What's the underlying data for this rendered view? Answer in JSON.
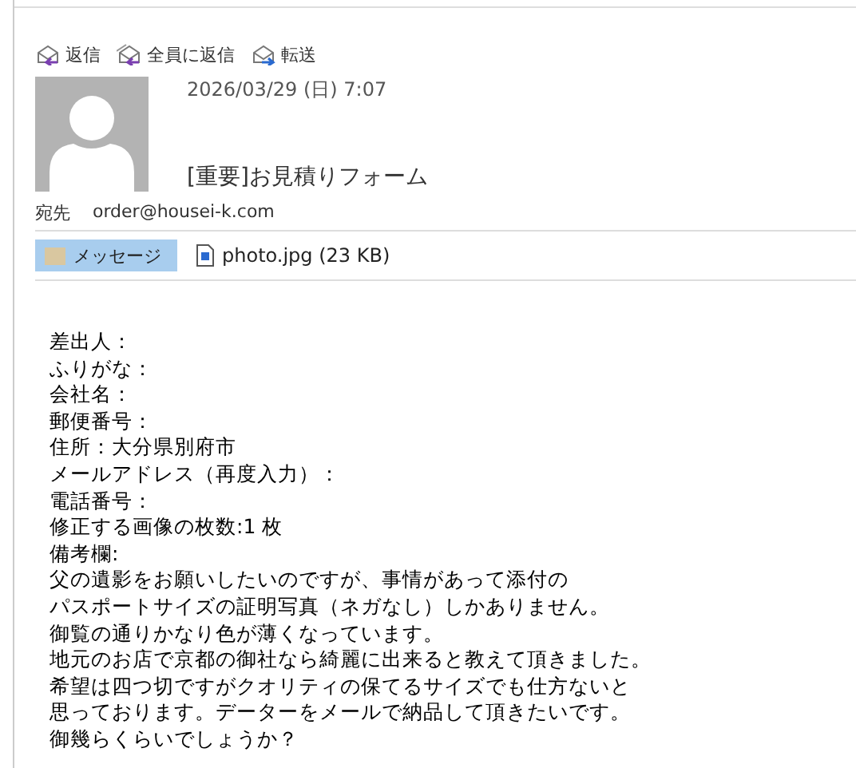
{
  "toolbar": [
    {
      "kind": "reply",
      "label": "返信"
    },
    {
      "kind": "reply_all",
      "label": "全員に返信"
    },
    {
      "kind": "forward",
      "label": "転送"
    }
  ],
  "message": {
    "date": "2026/03/29 (日) 7:07",
    "subject": "[重要]お見積りフォーム",
    "to_label": "宛先",
    "to": "order@housei-k.com"
  },
  "attachments": [
    {
      "kind": "message",
      "label": "メッセージ",
      "selected": true
    },
    {
      "kind": "file",
      "label": "photo.jpg (23 KB)",
      "selected": false
    }
  ],
  "body": [
    "差出人：",
    "ふりがな：",
    "会社名：",
    "郵便番号：",
    "住所：大分県別府市",
    "メールアドレス（再度入力）：",
    "電話番号：",
    "修正する画像の枚数:1 枚",
    "備考欄:",
    "父の遺影をお願いしたいのですが、事情があって添付の",
    "パスポートサイズの証明写真（ネガなし）しかありません。",
    "御覧の通りかなり色が薄くなっています。",
    "地元のお店で京都の御社なら綺麗に出来ると教えて頂きました。",
    "希望は四つ切ですがクオリティの保てるサイズでも仕方ないと",
    "思っております。データーをメールで納品して頂きたいです。",
    "御幾らくらいでしょうか？"
  ]
}
